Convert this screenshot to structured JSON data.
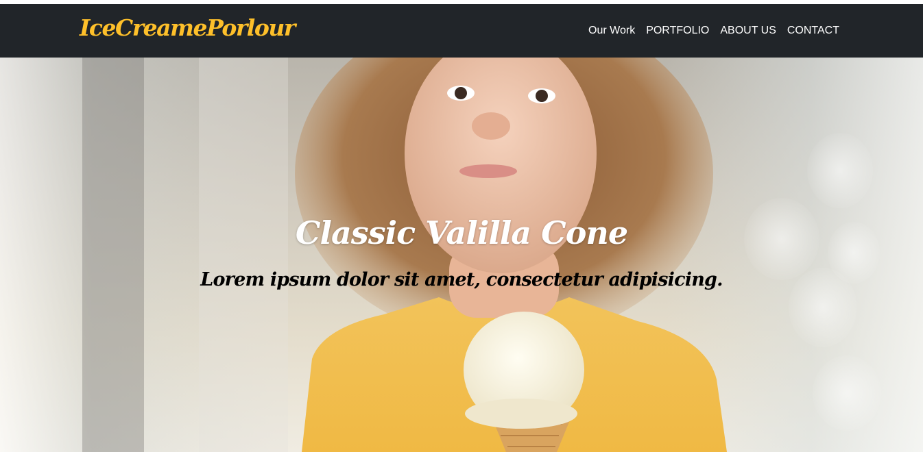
{
  "brand": {
    "name": "IceCreamePorlour",
    "color": "#fec02a"
  },
  "nav": {
    "items": [
      {
        "label": "Our Work"
      },
      {
        "label": "PORTFOLIO"
      },
      {
        "label": "ABOUT US"
      },
      {
        "label": "CONTACT"
      }
    ],
    "background": "#212529"
  },
  "hero": {
    "title": "Classic Valilla Cone",
    "subtitle": "Lorem ipsum dolor sit amet, consectetur adipisicing.",
    "image": "girl-holding-ice-cream-cone-photo"
  }
}
